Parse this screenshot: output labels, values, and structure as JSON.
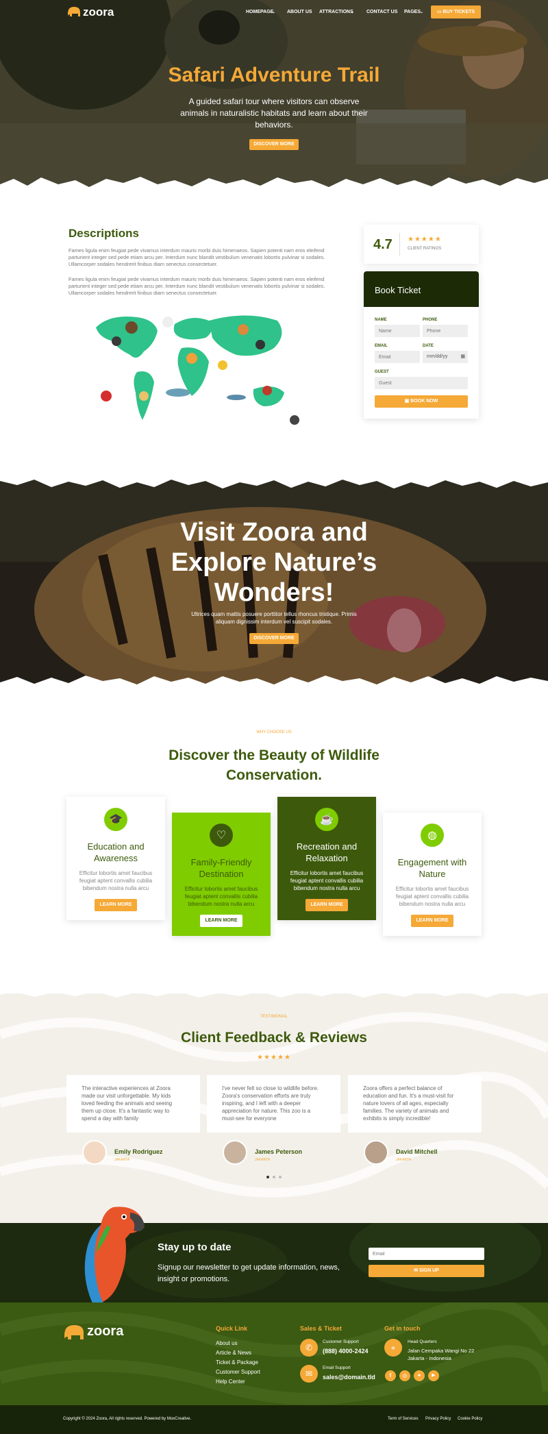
{
  "brand": {
    "name": "zoora"
  },
  "nav": {
    "items": [
      "HOMEPAGE",
      "ABOUT US",
      "ATTRACTIONS",
      "CONTACT US",
      "PAGES"
    ],
    "cta": "BUY TICKETS"
  },
  "hero": {
    "title": "Safari Adventure Trail",
    "subtitle": "A guided safari tour where visitors can observe animals in naturalistic habitats and learn about their behaviors.",
    "button": "DISCOVER MORE"
  },
  "descriptions": {
    "title": "Descriptions",
    "p1": "Fames ligula enim feugiat pede vivamus interdum mauris morbi duis himenaeos. Sapien potenti nam eros eleifend parturient integer sed pede etiam arcu per. Interdum nunc blandit vestibulum venenatis lobortis pulvinar si sodales. Ullamcorper sodales hendrerit finibus diam senectus consectetuer.",
    "p2": "Fames ligula enim feugiat pede vivamus interdum mauris morbi duis himenaeos. Sapien potenti nam eros eleifend parturient integer sed pede etiam arcu per. Interdum nunc blandit vestibulum venenatis lobortis pulvinar si sodales. Ullamcorper sodales hendrerit finibus diam senectus consectetuer."
  },
  "rating": {
    "value": "4.7",
    "label": "CLIENT RATINGS",
    "stars": "★★★★★"
  },
  "booking": {
    "title": "Book Ticket",
    "name_label": "NAME",
    "name_placeholder": "Name",
    "phone_label": "PHONE",
    "phone_placeholder": "Phone",
    "email_label": "EMAIL",
    "email_placeholder": "Email",
    "date_label": "DATE",
    "date_placeholder": "mm/dd/yy",
    "guest_label": "GUEST",
    "guest_placeholder": "Guest",
    "button": "BOOK NOW"
  },
  "visit": {
    "title_line1": "Visit Zoora and",
    "title_line2": "Explore Nature’s",
    "title_line3": "Wonders!",
    "text": "Ultrices quam mattis posuere porttitor tellus rhoncus tristique. Primis aliquam dignissim interdum vel suscipit sodales.",
    "button": "DISCOVER MORE"
  },
  "why": {
    "eyebrow": "WHY CHOOSE US",
    "title_line1": "Discover the Beauty of Wildlife",
    "title_line2": "Conservation.",
    "cards": [
      {
        "title_line1": "Education and",
        "title_line2": "Awareness",
        "text": "Efficitur lobortis amet faucibus feugiat aptent convallis cubilia bibendum nostra nulla arcu",
        "button": "LEARN MORE"
      },
      {
        "title_line1": "Family-Friendly",
        "title_line2": "Destination",
        "text": "Efficitur lobortis amet faucibus feugiat aptent convallis cubilia bibendum nostra nulla arcu",
        "button": "LEARN MORE"
      },
      {
        "title_line1": "Recreation and",
        "title_line2": "Relaxation",
        "text": "Efficitur lobortis amet faucibus feugiat aptent convallis cubilia bibendum nostra nulla arcu",
        "button": "LEARN MORE"
      },
      {
        "title_line1": "Engagement with",
        "title_line2": "Nature",
        "text": "Efficitur lobortis amet faucibus feugiat aptent convallis cubilia bibendum nostra nulla arcu",
        "button": "LEARN MORE"
      }
    ]
  },
  "testimonials": {
    "eyebrow": "TESTIMONIAL",
    "title": "Client Feedback & Reviews",
    "stars": "★★★★★",
    "items": [
      {
        "text": "The interactive experiences at Zoora made our visit unforgettable. My kids loved feeding the animals and seeing them up close. It's a fantastic way to spend a day with family",
        "name": "Emily Rodriguez",
        "city": "JAKARTA"
      },
      {
        "text": "I've never felt so close to wildlife before. Zoora's conservation efforts are truly inspiring, and I left with a deeper appreciation for nature. This zoo is a must-see for everyone",
        "name": "James Peterson",
        "city": "JAKARTA"
      },
      {
        "text": "Zoora offers a perfect balance of education and fun. It's a must-visit for nature lovers of all ages, especially families. The variety of animals and exhibits is simply incredible!",
        "name": "David Mitchell",
        "city": "JAKARTA"
      }
    ]
  },
  "newsletter": {
    "title": "Stay up to date",
    "text": "Signup our newsletter to get update information, news, insight or promotions.",
    "email_placeholder": "Email",
    "button": "SIGN UP"
  },
  "footer": {
    "quick_title": "Quick Link",
    "quick_links": [
      "About us",
      "Article & News",
      "Ticket & Package",
      "Customer Support",
      "Help Center"
    ],
    "sales_title": "Sales & Ticket",
    "support_label": "Customer Support",
    "support_phone": "(888) 4000-2424",
    "email_label": "Email Support",
    "email": "sales@domain.tld",
    "touch_title": "Get in touch",
    "hq_label": "Head Quarters",
    "hq_line1": "Jalan Cempaka Wangi No 22",
    "hq_line2": "Jakarta - Indonesia",
    "copyright": "Copyright © 2024 Zoora, All rights reserved. Powered by MoxCreative.",
    "legal": [
      "Term of Services",
      "Privacy Policy",
      "Cookie Policy"
    ]
  },
  "colors": {
    "accent": "#f5a937",
    "green_dark": "#3d5a0c",
    "green_bright": "#7fcc00",
    "footer_bg": "#3b5a12"
  }
}
